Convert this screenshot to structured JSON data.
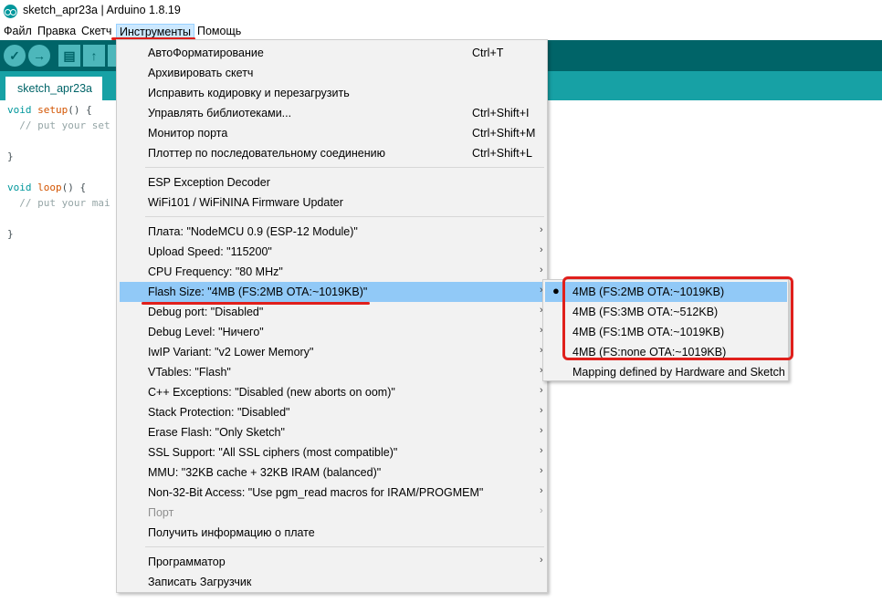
{
  "window": {
    "title": "sketch_apr23a | Arduino 1.8.19"
  },
  "menubar": {
    "items": [
      {
        "label": "Файл"
      },
      {
        "label": "Правка"
      },
      {
        "label": "Скетч"
      },
      {
        "label": "Инструменты"
      },
      {
        "label": "Помощь"
      }
    ]
  },
  "toolbar": {
    "buttons": [
      "verify-icon",
      "upload-icon",
      "new-icon",
      "open-icon",
      "save-icon"
    ]
  },
  "tab": {
    "label": "sketch_apr23a"
  },
  "editor": {
    "lines": [
      {
        "type": "void",
        "fn": " setup",
        "rest": "() {"
      },
      {
        "comment": "  // put your set"
      },
      {
        "text": "}"
      },
      {
        "type": "void",
        "fn": " loop",
        "rest": "() {"
      },
      {
        "comment": "  // put your mai"
      },
      {
        "text": "}"
      }
    ]
  },
  "tools_menu": {
    "items": [
      {
        "label": "АвтоФорматирование",
        "shortcut": "Ctrl+T"
      },
      {
        "label": "Архивировать скетч",
        "shortcut": ""
      },
      {
        "label": "Исправить кодировку и перезагрузить",
        "shortcut": ""
      },
      {
        "label": "Управлять библиотеками...",
        "shortcut": "Ctrl+Shift+I"
      },
      {
        "label": "Монитор порта",
        "shortcut": "Ctrl+Shift+M"
      },
      {
        "label": "Плоттер по последовательному соединению",
        "shortcut": "Ctrl+Shift+L"
      },
      {
        "label": "ESP Exception Decoder"
      },
      {
        "label": "WiFi101 / WiFiNINA Firmware Updater"
      },
      {
        "label": "Плата: \"NodeMCU 0.9 (ESP-12 Module)\""
      },
      {
        "label": "Upload Speed: \"115200\""
      },
      {
        "label": "CPU Frequency: \"80 MHz\""
      },
      {
        "label": "Flash Size: \"4MB (FS:2MB OTA:~1019KB)\""
      },
      {
        "label": "Debug port: \"Disabled\""
      },
      {
        "label": "Debug Level: \"Ничего\""
      },
      {
        "label": "IwIP Variant: \"v2 Lower Memory\""
      },
      {
        "label": "VTables: \"Flash\""
      },
      {
        "label": "C++ Exceptions: \"Disabled (new aborts on oom)\""
      },
      {
        "label": "Stack Protection: \"Disabled\""
      },
      {
        "label": "Erase Flash: \"Only Sketch\""
      },
      {
        "label": "SSL Support: \"All SSL ciphers (most compatible)\""
      },
      {
        "label": "MMU: \"32KB cache + 32KB IRAM (balanced)\""
      },
      {
        "label": "Non-32-Bit Access: \"Use pgm_read macros for IRAM/PROGMEM\""
      },
      {
        "label": "Порт"
      },
      {
        "label": "Получить информацию о плате"
      },
      {
        "label": "Программатор"
      },
      {
        "label": "Записать Загрузчик"
      }
    ]
  },
  "flash_submenu": {
    "items": [
      {
        "label": "4MB (FS:2MB OTA:~1019KB)",
        "selected": true
      },
      {
        "label": "4MB (FS:3MB OTA:~512KB)"
      },
      {
        "label": "4MB (FS:1MB OTA:~1019KB)"
      },
      {
        "label": "4MB (FS:none OTA:~1019KB)"
      },
      {
        "label": "Mapping defined by Hardware and Sketch"
      }
    ],
    "bullet": "●"
  },
  "colors": {
    "toolbar": "#006468",
    "tabbar": "#17a1a5",
    "highlight": "#91c9f7",
    "annotation": "#e0201c"
  }
}
